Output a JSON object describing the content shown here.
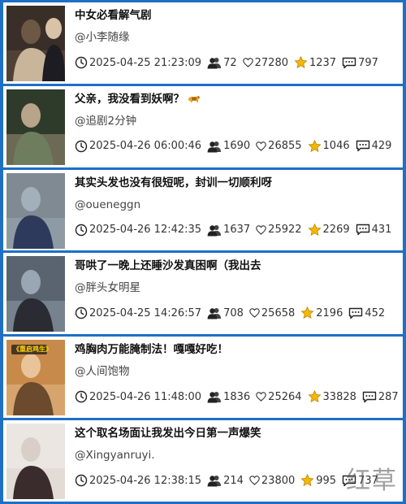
{
  "feed": {
    "items": [
      {
        "title": "中女必看解气剧",
        "author": "@小李随缘",
        "datetime": "2025-04-25 21:23:09",
        "users": "72",
        "likes": "27280",
        "favorites": "1237",
        "comments": "797",
        "thumb_colors": [
          "#3a2f28",
          "#c9b59a",
          "#6d5846"
        ]
      },
      {
        "title": "父亲，我没看到妖啊？",
        "title_emoji": "tiger-icon",
        "author": "@追剧2分钟",
        "datetime": "2025-04-26 06:00:46",
        "users": "1690",
        "likes": "26855",
        "favorites": "1046",
        "comments": "429",
        "thumb_colors": [
          "#2f3b2a",
          "#6e7d5e",
          "#b8a48a"
        ]
      },
      {
        "title": "其实头发也没有很短呢，封训一切顺利呀",
        "author": "@oueneggn",
        "datetime": "2025-04-26 12:42:35",
        "users": "1637",
        "likes": "25922",
        "favorites": "2269",
        "comments": "431",
        "thumb_colors": [
          "#7f8a93",
          "#2d3a5c",
          "#a3b0ba"
        ]
      },
      {
        "title": "哥哄了一晚上还睡沙发真困啊（我出去",
        "author": "@胖头女明星",
        "datetime": "2025-04-25 14:26:57",
        "users": "708",
        "likes": "25658",
        "favorites": "2196",
        "comments": "452",
        "thumb_colors": [
          "#5a6470",
          "#2b2b33",
          "#9aa6b4"
        ]
      },
      {
        "title": "鸡胸肉万能腌制法！嘎嘎好吃！",
        "author": "@人间饱物",
        "datetime": "2025-04-26 11:48:00",
        "users": "1836",
        "likes": "25264",
        "favorites": "33828",
        "comments": "287",
        "thumb_badge": "《重启鸡生》",
        "thumb_colors": [
          "#c88a4a",
          "#6b4a2e",
          "#e9c49a"
        ]
      },
      {
        "title": "这个取名场面让我发出今日第一声爆笑",
        "author": "@Xingyanruyi.",
        "datetime": "2025-04-26 12:38:15",
        "users": "214",
        "likes": "23800",
        "favorites": "995",
        "comments": "737",
        "thumb_colors": [
          "#ebe6e2",
          "#3a2c2c",
          "#d9cfc8"
        ]
      }
    ]
  },
  "watermark": "红草",
  "colors": {
    "frame": "#1f6fc4",
    "star": "#f5b800",
    "text": "#111111"
  }
}
